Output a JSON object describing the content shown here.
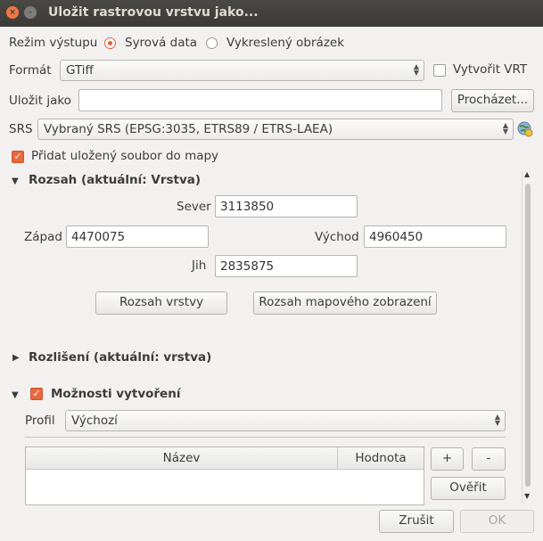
{
  "window": {
    "title": "Uložit rastrovou vrstvu jako...",
    "close_glyph": "×",
    "min_glyph": "–"
  },
  "output_mode": {
    "label": "Režim výstupu",
    "options": [
      "Syrová data",
      "Vykreslený obrázek"
    ],
    "selected": 0
  },
  "format": {
    "label": "Formát",
    "value": "GTiff",
    "vrt_label": "Vytvořit VRT",
    "vrt_checked": false
  },
  "save_as": {
    "label": "Uložit jako",
    "value": "",
    "browse_label": "Procházet..."
  },
  "srs": {
    "label": "SRS",
    "value": "Vybraný SRS (EPSG:3035, ETRS89 / ETRS-LAEA)",
    "icon": "globe-icon"
  },
  "add_to_map": {
    "label": "Přidat uložený soubor do mapy",
    "checked": true
  },
  "extent": {
    "header": "Rozsah (aktuální: Vrstva)",
    "expanded": true,
    "north_label": "Sever",
    "north": "3113850",
    "west_label": "Západ",
    "west": "4470075",
    "east_label": "Východ",
    "east": "4960450",
    "south_label": "Jih",
    "south": "2835875",
    "layer_extent_button": "Rozsah vrstvy",
    "map_extent_button": "Rozsah mapového zobrazení"
  },
  "resolution": {
    "header": "Rozlišení (aktuální: vrstva)",
    "expanded": false
  },
  "create_options": {
    "header": "Možnosti vytvoření",
    "checked": true,
    "expanded": true,
    "profile_label": "Profil",
    "profile_value": "Výchozí",
    "columns": [
      "Název",
      "Hodnota"
    ],
    "add_label": "+",
    "remove_label": "-",
    "validate_label": "Ověřit"
  },
  "footer": {
    "cancel_label": "Zrušit",
    "ok_label": "OK",
    "ok_enabled": false
  },
  "colors": {
    "accent": "#e9673d",
    "titlebar": "#3b3a36",
    "background": "#f2f1f0"
  }
}
